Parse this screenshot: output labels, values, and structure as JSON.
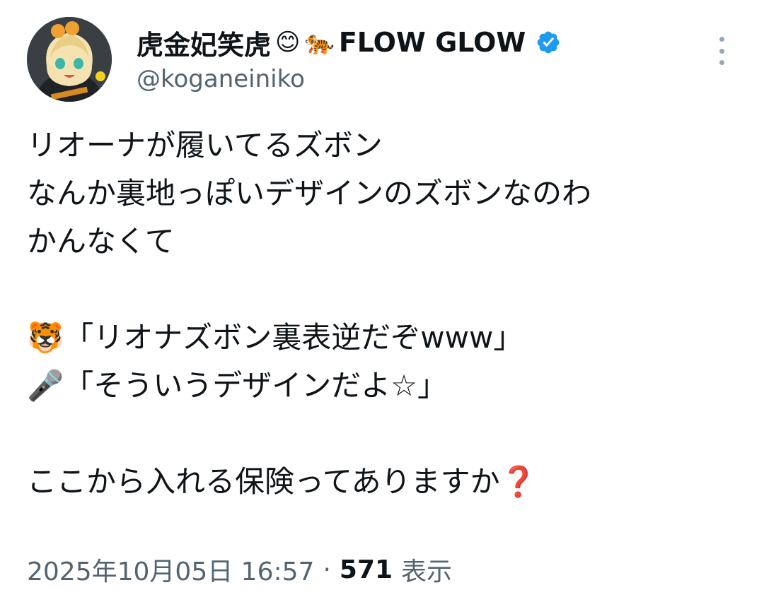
{
  "author": {
    "name": "虎金妃笑虎",
    "name_emoji_1": "😊",
    "name_emoji_2": "🐅",
    "name_suffix": "FLOW GLOW",
    "handle": "@koganeiniko",
    "verified": true
  },
  "tweet": {
    "lines": [
      "リオーナが履いてるズボン",
      "なんか裏地っぽいデザインのズボンなのわ",
      "かんなくて",
      "",
      "🐯「リオナズボン裏表逆だぞwww」",
      "🎤「そういうデザインだよ☆」",
      "",
      "ここから入れる保険ってありますか❓"
    ]
  },
  "meta": {
    "date": "2025年10月05日 16:57",
    "separator": "·",
    "views_count": "571",
    "views_label": "表示"
  },
  "colors": {
    "text": "#0f1419",
    "secondary": "#536471",
    "verified": "#1d9bf0"
  }
}
